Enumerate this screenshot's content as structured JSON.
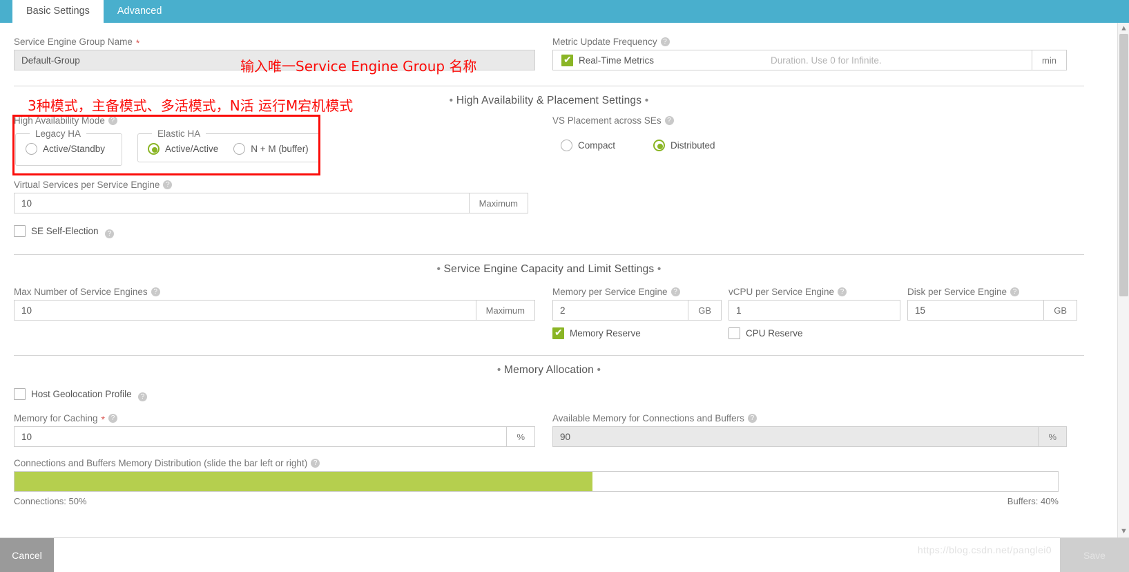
{
  "tabs": [
    {
      "label": "Basic Settings",
      "active": true
    },
    {
      "label": "Advanced",
      "active": false
    }
  ],
  "colors": {
    "tab_bar": "#49afcd",
    "accent_green": "#8ab525",
    "slider_green": "#b5cf4e",
    "annotation_red": "#fb0d0a",
    "required_red": "#d9534f"
  },
  "se_group_name": {
    "label": "Service Engine Group Name",
    "required": true,
    "value": "Default-Group",
    "readonly": true
  },
  "metric_update_frequency": {
    "label": "Metric Update Frequency",
    "help": "?",
    "realtime_metrics_label": "Real-Time Metrics",
    "realtime_metrics_checked": true,
    "duration_placeholder": "Duration. Use 0 for Infinite.",
    "duration_value": "",
    "unit": "min"
  },
  "sections": {
    "ha_placement": "High Availability & Placement Settings",
    "capacity": "Service Engine Capacity and Limit Settings",
    "memory_allocation": "Memory Allocation",
    "bullet": "•"
  },
  "high_availability_mode": {
    "label": "High Availability Mode",
    "legacy_legend": "Legacy HA",
    "elastic_legend": "Elastic HA",
    "options": [
      {
        "label": "Active/Standby",
        "group": "legacy",
        "selected": false
      },
      {
        "label": "Active/Active",
        "group": "elastic",
        "selected": true
      },
      {
        "label": "N + M (buffer)",
        "group": "elastic",
        "selected": false
      }
    ]
  },
  "vs_placement": {
    "label": "VS Placement across SEs",
    "options": [
      {
        "label": "Compact",
        "selected": false
      },
      {
        "label": "Distributed",
        "selected": true
      }
    ]
  },
  "virtual_services_per_se": {
    "label": "Virtual Services per Service Engine",
    "value": "10",
    "addon": "Maximum"
  },
  "se_self_election": {
    "label": "SE Self-Election",
    "checked": false
  },
  "max_number_of_ses": {
    "label": "Max Number of Service Engines",
    "value": "10",
    "addon": "Maximum"
  },
  "memory_per_se": {
    "label": "Memory per Service Engine",
    "value": "2",
    "addon": "GB"
  },
  "vcpu_per_se": {
    "label": "vCPU per Service Engine",
    "value": "1",
    "addon": ""
  },
  "disk_per_se": {
    "label": "Disk per Service Engine",
    "value": "15",
    "addon": "GB"
  },
  "memory_reserve": {
    "label": "Memory Reserve",
    "checked": true
  },
  "cpu_reserve": {
    "label": "CPU Reserve",
    "checked": false
  },
  "host_geolocation_profile": {
    "label": "Host Geolocation Profile",
    "checked": false
  },
  "memory_for_caching": {
    "label": "Memory for Caching",
    "required": true,
    "value": "10",
    "addon": "%"
  },
  "available_memory": {
    "label": "Available Memory for Connections and Buffers",
    "value": "90",
    "addon": "%",
    "readonly": true
  },
  "memory_distribution": {
    "label": "Connections and Buffers Memory Distribution (slide the bar left or right)",
    "fill_percent": 55,
    "connections_label": "Connections: 50%",
    "buffers_label": "Buffers: 40%"
  },
  "footer": {
    "cancel_label": "Cancel",
    "save_label": "Save",
    "watermark": "https://blog.csdn.net/panglei0"
  },
  "annotations": [
    {
      "id": "name-hint",
      "text": "输入唯一Service Engine Group 名称"
    },
    {
      "id": "ha-hint",
      "text": "3种模式，主备模式、多活模式，N活 运行M宕机模式"
    }
  ],
  "icons": {
    "help": "?",
    "check": "✔",
    "scroll_up": "▲",
    "scroll_down": "▼"
  }
}
